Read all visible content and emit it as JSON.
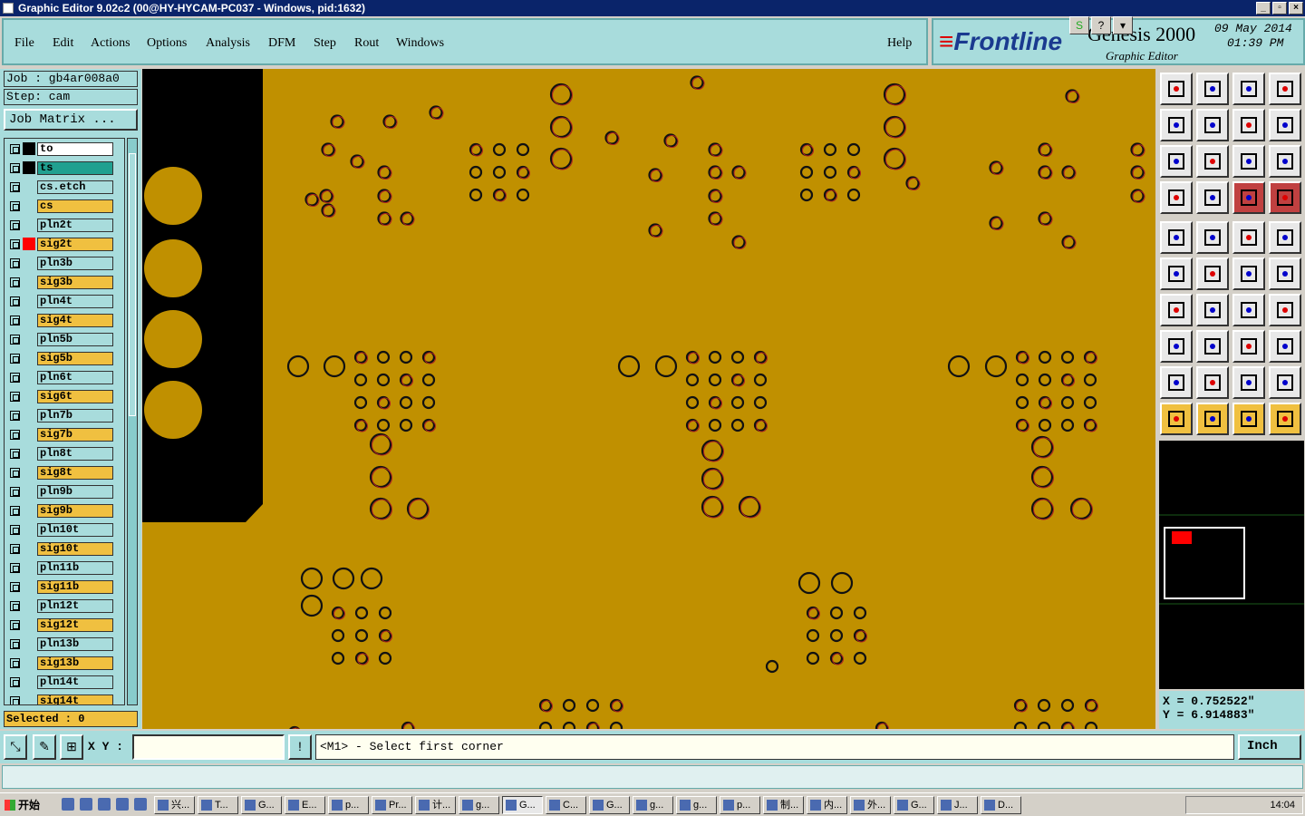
{
  "window": {
    "title": "Graphic Editor 9.02c2 (00@HY-HYCAM-PC037 - Windows, pid:1632)"
  },
  "menu": [
    {
      "label": "File"
    },
    {
      "label": "Edit"
    },
    {
      "label": "Actions"
    },
    {
      "label": "Options"
    },
    {
      "label": "Analysis"
    },
    {
      "label": "DFM"
    },
    {
      "label": "Step"
    },
    {
      "label": "Rout"
    },
    {
      "label": "Windows"
    },
    {
      "label": "Help"
    }
  ],
  "header": {
    "brand": "Frontline",
    "product": "Genesis 2000",
    "subtitle": "Graphic Editor",
    "date": "09 May 2014",
    "time": "01:39 PM"
  },
  "job": {
    "job_text": "Job : gb4ar008a0",
    "step_text": "Step: cam",
    "matrix_button": "Job Matrix ..."
  },
  "layers": [
    {
      "name": "to",
      "color": "#ffffff",
      "swatch": "#000000"
    },
    {
      "name": "ts",
      "color": "#20a090",
      "swatch": "#000000"
    },
    {
      "name": "cs.etch",
      "color": "#a8dcdc",
      "swatch": "#a8dcdc"
    },
    {
      "name": "cs",
      "color": "#f0c040",
      "swatch": "#a8dcdc"
    },
    {
      "name": "pln2t",
      "color": "#a8dcdc",
      "swatch": "#a8dcdc"
    },
    {
      "name": "sig2t",
      "color": "#f0c040",
      "swatch": "#ff0000"
    },
    {
      "name": "pln3b",
      "color": "#a8dcdc",
      "swatch": "#a8dcdc"
    },
    {
      "name": "sig3b",
      "color": "#f0c040",
      "swatch": "#a8dcdc"
    },
    {
      "name": "pln4t",
      "color": "#a8dcdc",
      "swatch": "#a8dcdc"
    },
    {
      "name": "sig4t",
      "color": "#f0c040",
      "swatch": "#a8dcdc"
    },
    {
      "name": "pln5b",
      "color": "#a8dcdc",
      "swatch": "#a8dcdc"
    },
    {
      "name": "sig5b",
      "color": "#f0c040",
      "swatch": "#a8dcdc"
    },
    {
      "name": "pln6t",
      "color": "#a8dcdc",
      "swatch": "#a8dcdc"
    },
    {
      "name": "sig6t",
      "color": "#f0c040",
      "swatch": "#a8dcdc"
    },
    {
      "name": "pln7b",
      "color": "#a8dcdc",
      "swatch": "#a8dcdc"
    },
    {
      "name": "sig7b",
      "color": "#f0c040",
      "swatch": "#a8dcdc"
    },
    {
      "name": "pln8t",
      "color": "#a8dcdc",
      "swatch": "#a8dcdc"
    },
    {
      "name": "sig8t",
      "color": "#f0c040",
      "swatch": "#a8dcdc"
    },
    {
      "name": "pln9b",
      "color": "#a8dcdc",
      "swatch": "#a8dcdc"
    },
    {
      "name": "sig9b",
      "color": "#f0c040",
      "swatch": "#a8dcdc"
    },
    {
      "name": "pln10t",
      "color": "#a8dcdc",
      "swatch": "#a8dcdc"
    },
    {
      "name": "sig10t",
      "color": "#f0c040",
      "swatch": "#a8dcdc"
    },
    {
      "name": "pln11b",
      "color": "#a8dcdc",
      "swatch": "#a8dcdc"
    },
    {
      "name": "sig11b",
      "color": "#f0c040",
      "swatch": "#a8dcdc"
    },
    {
      "name": "pln12t",
      "color": "#a8dcdc",
      "swatch": "#a8dcdc"
    },
    {
      "name": "sig12t",
      "color": "#f0c040",
      "swatch": "#a8dcdc"
    },
    {
      "name": "pln13b",
      "color": "#a8dcdc",
      "swatch": "#a8dcdc"
    },
    {
      "name": "sig13b",
      "color": "#f0c040",
      "swatch": "#a8dcdc"
    },
    {
      "name": "pln14t",
      "color": "#a8dcdc",
      "swatch": "#a8dcdc"
    },
    {
      "name": "sig14t",
      "color": "#f0c040",
      "swatch": "#a8dcdc"
    }
  ],
  "selected_text": "Selected : 0",
  "coords": {
    "x_text": "X = 0.752522\"",
    "y_text": "Y = 6.914883\""
  },
  "bottom": {
    "xy_label": "X Y :",
    "xy_value": "",
    "prompt": "<M1> - Select first corner",
    "unit": "Inch"
  },
  "taskbar": {
    "start": "开始",
    "clock": "14:04",
    "tasks": [
      "兴...",
      "T...",
      "G...",
      "E...",
      "p...",
      "Pr...",
      "计...",
      "g...",
      "G...",
      "C...",
      "G...",
      "g...",
      "g...",
      "p...",
      "制...",
      "内...",
      "外...",
      "G...",
      "J...",
      "D..."
    ]
  },
  "colors": {
    "board": "#c09000",
    "panel": "#a8dcdc",
    "title": "#0a246a"
  },
  "tools": [
    "layer-display-icon",
    "zoom-home-icon",
    "home-icon",
    "window-icon",
    "pan-left-icon",
    "pan-right-icon",
    "undo-view-icon",
    "redraw-icon",
    "zoom-fit-icon",
    "zoom-center-icon",
    "scale-1-2-icon",
    "help-icon",
    "settings-icon",
    "grid-icon",
    "snap-icon",
    "snap2-icon",
    "camera-icon",
    "shape-icon",
    "ruler-icon",
    "dot-icon",
    "net-icon",
    "cross-icon",
    "line-node-icon",
    "line-node2-icon",
    "angle-icon",
    "diagonal-icon",
    "arc-icon",
    "fiducial-icon",
    "pad-icon",
    "segment-icon",
    "measure-icon",
    "pattern-icon",
    "triangle-icon",
    "triangle2-icon",
    "triangle3-icon",
    "triangle4-icon",
    "select-icon",
    "select2-icon",
    "select3-icon",
    "route-icon"
  ]
}
